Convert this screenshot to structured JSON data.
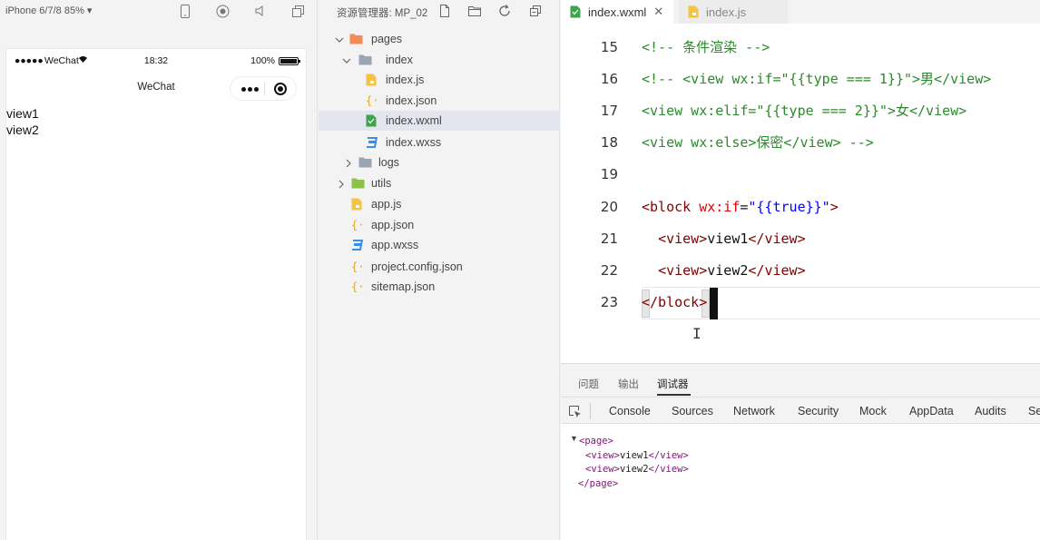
{
  "simulator": {
    "device_label": "iPhone 6/7/8 85% ▾",
    "status_bar": {
      "signal": "●●●●●",
      "carrier": "WeChat",
      "time": "18:32",
      "battery": "100%"
    },
    "nav_title": "WeChat",
    "page_lines": [
      "view1",
      "view2"
    ]
  },
  "explorer": {
    "title": "资源管理器: MP_02",
    "tree": [
      {
        "label": "pages",
        "icon": "folder-pages-icon",
        "expanded": true
      },
      {
        "label": "index",
        "icon": "folder-icon",
        "expanded": true
      },
      {
        "label": "index.js",
        "icon": "js-file-icon"
      },
      {
        "label": "index.json",
        "icon": "json-file-icon"
      },
      {
        "label": "index.wxml",
        "icon": "wxml-file-icon",
        "selected": true
      },
      {
        "label": "index.wxss",
        "icon": "wxss-file-icon"
      },
      {
        "label": "logs",
        "icon": "folder-icon",
        "expanded": false
      },
      {
        "label": "utils",
        "icon": "folder-utils-icon",
        "expanded": false
      },
      {
        "label": "app.js",
        "icon": "js-file-icon"
      },
      {
        "label": "app.json",
        "icon": "json-file-icon"
      },
      {
        "label": "app.wxss",
        "icon": "wxss-file-icon"
      },
      {
        "label": "project.config.json",
        "icon": "json-file-icon"
      },
      {
        "label": "sitemap.json",
        "icon": "json-file-icon"
      }
    ]
  },
  "editor": {
    "tabs": [
      {
        "label": "index.wxml",
        "active": true
      },
      {
        "label": "index.js",
        "active": false
      }
    ],
    "close_glyph": "✕",
    "lines": [
      {
        "num": "15",
        "tokens": [
          [
            "c-comment",
            "<!-- 条件渲染 -->"
          ]
        ]
      },
      {
        "num": "16",
        "tokens": [
          [
            "c-comment",
            "<!-- <view wx:if=\"{{type === 1}}\">男</view>"
          ]
        ]
      },
      {
        "num": "17",
        "tokens": [
          [
            "c-comment",
            "<view wx:elif=\"{{type === 2}}\">女</view>"
          ]
        ]
      },
      {
        "num": "18",
        "tokens": [
          [
            "c-comment",
            "<view wx:else>保密</view> -->"
          ]
        ]
      },
      {
        "num": "19",
        "tokens": []
      },
      {
        "num": "20",
        "tokens": [
          [
            "c-tag",
            "<block "
          ],
          [
            "c-attr",
            "wx:if"
          ],
          [
            "c-text",
            "="
          ],
          [
            "c-str",
            "\"{{true}}\""
          ],
          [
            "c-tag",
            ">"
          ]
        ]
      },
      {
        "num": "21",
        "tokens": [
          [
            "c-text",
            "  "
          ],
          [
            "c-tag",
            "<view>"
          ],
          [
            "c-text",
            "view1"
          ],
          [
            "c-tag",
            "</view>"
          ]
        ]
      },
      {
        "num": "22",
        "tokens": [
          [
            "c-text",
            "  "
          ],
          [
            "c-tag",
            "<view>"
          ],
          [
            "c-text",
            "view2"
          ],
          [
            "c-tag",
            "</view>"
          ]
        ]
      },
      {
        "num": "23",
        "tokens": [
          [
            "c-tag",
            "</block>"
          ]
        ]
      }
    ]
  },
  "panel": {
    "tabs": [
      "问题",
      "输出",
      "调试器"
    ],
    "active_tab": "调试器",
    "devtools_tabs": [
      "Console",
      "Sources",
      "Network",
      "Security",
      "Mock",
      "AppData",
      "Audits",
      "Se"
    ],
    "dom": {
      "arrow": "▼",
      "open": "<page>",
      "children": [
        {
          "open": "<view>",
          "text": "view1",
          "close": "</view>"
        },
        {
          "open": "<view>",
          "text": "view2",
          "close": "</view>"
        }
      ],
      "close": "</page>"
    }
  }
}
